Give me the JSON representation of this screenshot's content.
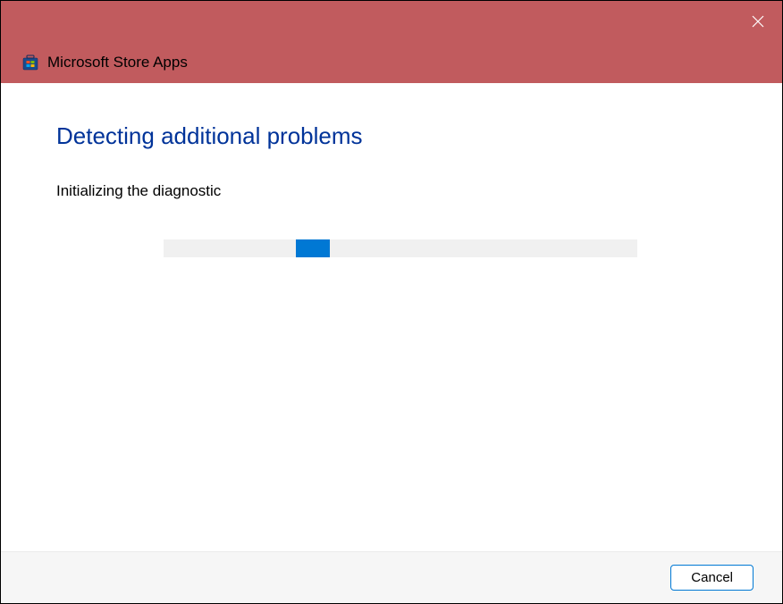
{
  "window": {
    "title": "Microsoft Store Apps"
  },
  "content": {
    "heading": "Detecting additional problems",
    "status": "Initializing the diagnostic"
  },
  "footer": {
    "cancel_label": "Cancel"
  },
  "colors": {
    "titlebar": "#c15b5e",
    "heading": "#003399",
    "progress_fill": "#0078d4"
  }
}
